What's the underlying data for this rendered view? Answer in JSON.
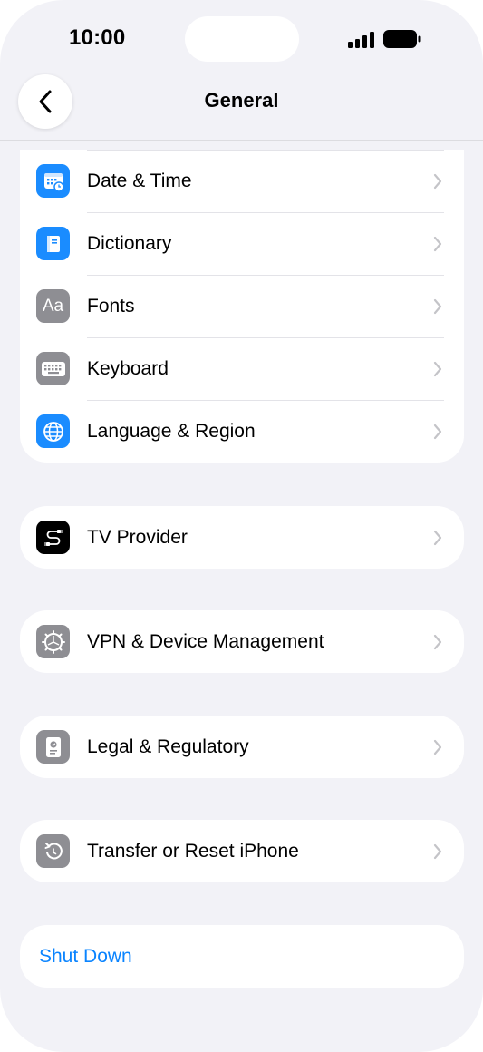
{
  "status_bar": {
    "time": "10:00"
  },
  "nav": {
    "title": "General"
  },
  "groups": [
    {
      "items": [
        {
          "label": "Date & Time",
          "icon": "calendar-clock-icon",
          "icon_bg": "#1a8cff"
        },
        {
          "label": "Dictionary",
          "icon": "book-icon",
          "icon_bg": "#1a8cff"
        },
        {
          "label": "Fonts",
          "icon": "fonts-icon",
          "icon_bg": "#8e8e93",
          "icon_text": "Aa"
        },
        {
          "label": "Keyboard",
          "icon": "keyboard-icon",
          "icon_bg": "#8e8e93"
        },
        {
          "label": "Language & Region",
          "icon": "globe-icon",
          "icon_bg": "#1a8cff"
        }
      ]
    },
    {
      "items": [
        {
          "label": "TV Provider",
          "icon": "tv-provider-icon",
          "icon_bg": "#000000"
        }
      ]
    },
    {
      "items": [
        {
          "label": "VPN & Device Management",
          "icon": "gear-icon",
          "icon_bg": "#8e8e93"
        }
      ]
    },
    {
      "items": [
        {
          "label": "Legal & Regulatory",
          "icon": "certificate-icon",
          "icon_bg": "#8e8e93"
        }
      ]
    },
    {
      "items": [
        {
          "label": "Transfer or Reset iPhone",
          "icon": "reset-icon",
          "icon_bg": "#8e8e93"
        }
      ]
    }
  ],
  "shutdown": {
    "label": "Shut Down",
    "color": "#0a84ff"
  }
}
